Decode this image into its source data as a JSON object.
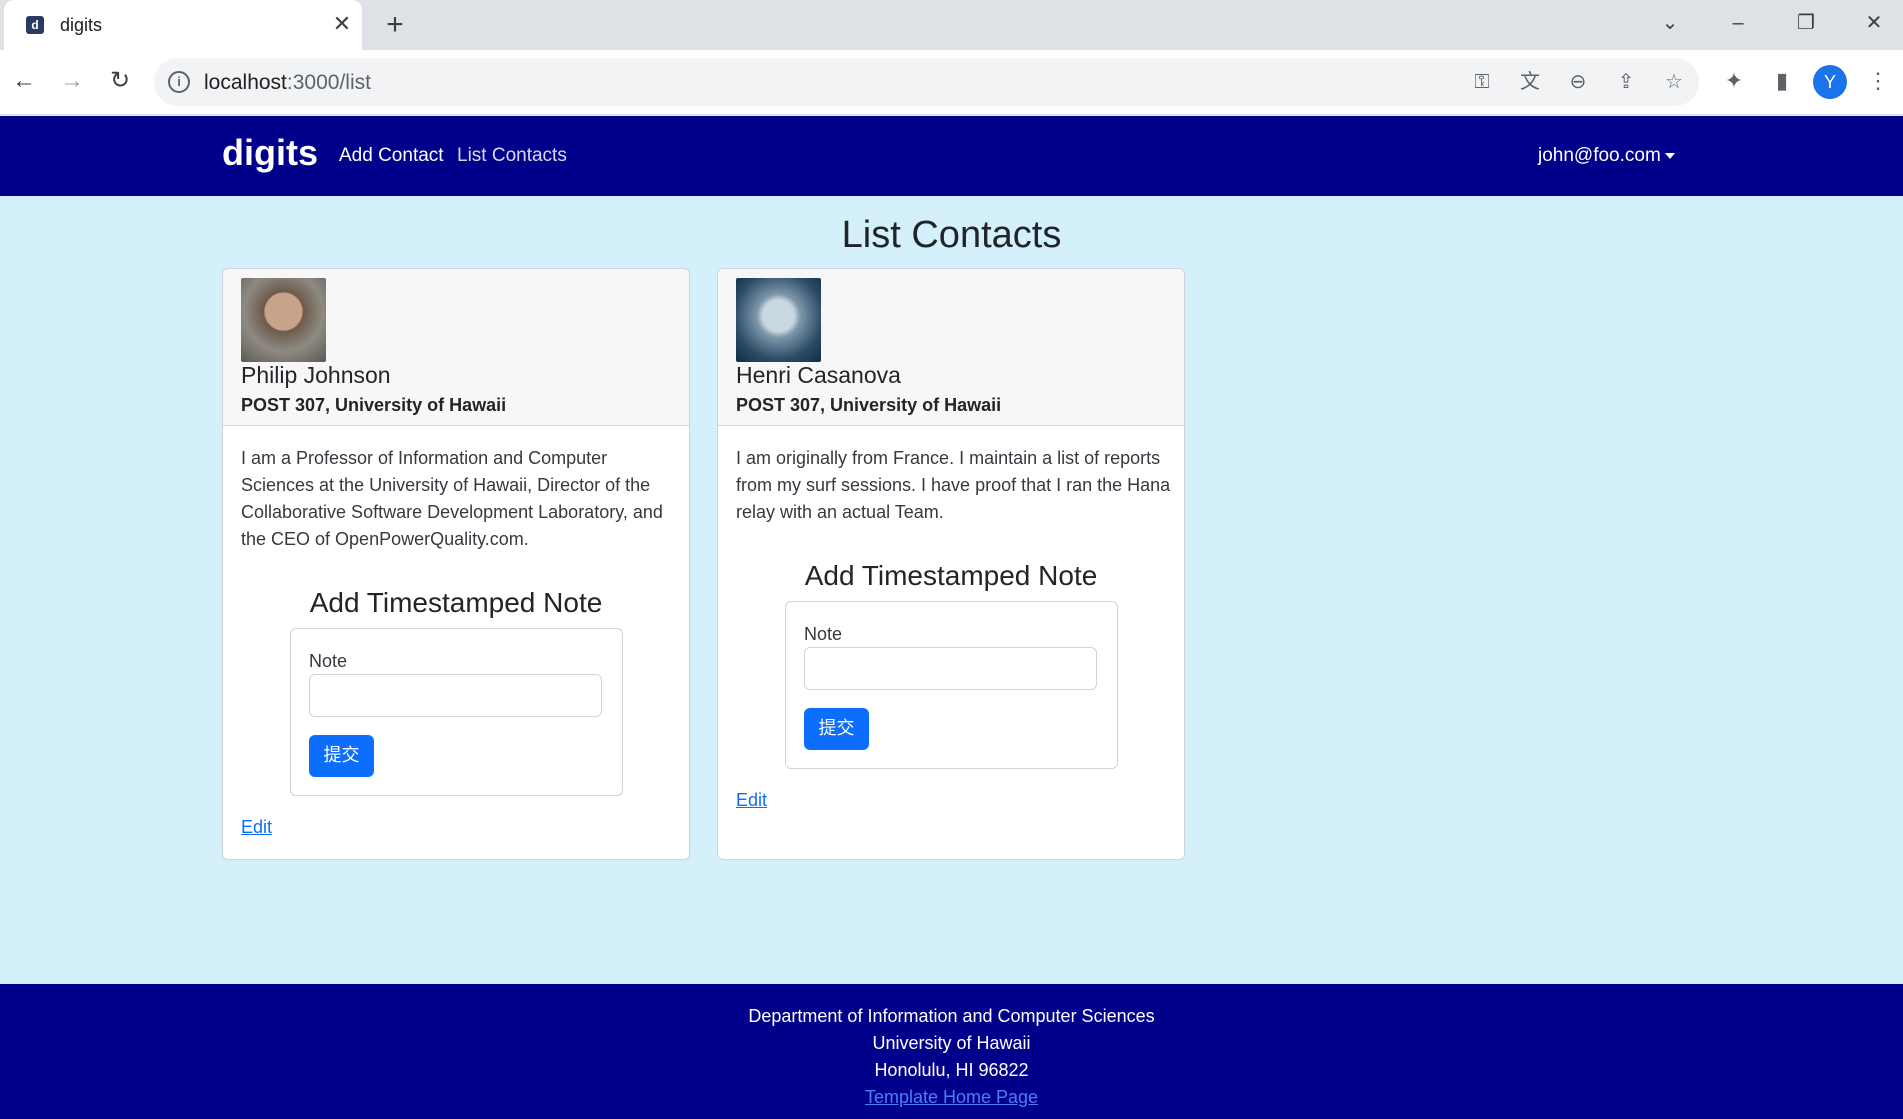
{
  "browser": {
    "tab_title": "digits",
    "url_host": "localhost",
    "url_path": ":3000/list",
    "profile_initial": "Y"
  },
  "nav": {
    "brand": "digits",
    "links": [
      "Add Contact",
      "List Contacts"
    ],
    "user": "john@foo.com"
  },
  "page": {
    "title": "List Contacts"
  },
  "contacts": [
    {
      "name": "Philip Johnson",
      "address": "POST 307, University of Hawaii",
      "description": "I am a Professor of Information and Computer Sciences at the University of Hawaii, Director of the Collaborative Software Development Laboratory, and the CEO of OpenPowerQuality.com.",
      "note_title": "Add Timestamped Note",
      "note_label": "Note",
      "submit_label": "提交",
      "edit_label": "Edit"
    },
    {
      "name": "Henri Casanova",
      "address": "POST 307, University of Hawaii",
      "description": "I am originally from France. I maintain a list of reports from my surf sessions. I have proof that I ran the Hana relay with an actual Team.",
      "note_title": "Add Timestamped Note",
      "note_label": "Note",
      "submit_label": "提交",
      "edit_label": "Edit"
    }
  ],
  "footer": {
    "line1": "Department of Information and Computer Sciences",
    "line2": "University of Hawaii",
    "line3": "Honolulu, HI 96822",
    "link": "Template Home Page"
  }
}
